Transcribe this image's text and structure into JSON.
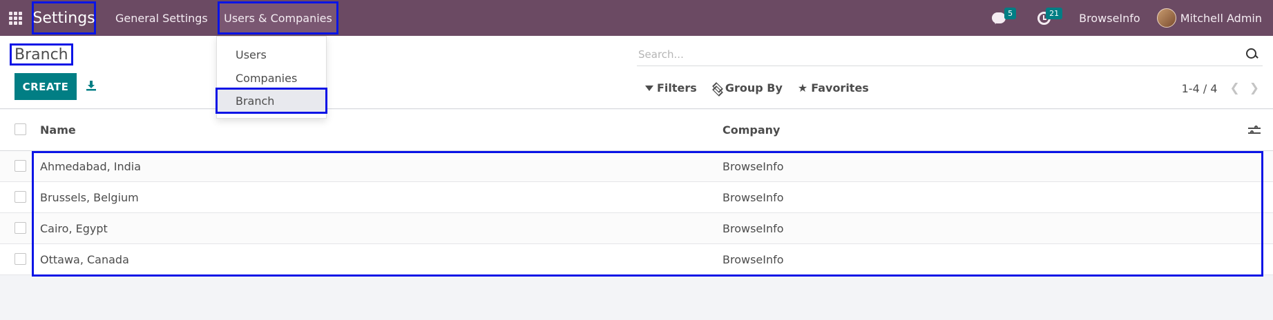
{
  "navbar": {
    "app_name": "Settings",
    "menu": [
      "General Settings",
      "Users & Companies"
    ],
    "messages_count": "5",
    "activities_count": "21",
    "company": "BrowseInfo",
    "user": "Mitchell Admin"
  },
  "dropdown": {
    "items": [
      "Users",
      "Companies",
      "Branch"
    ]
  },
  "control": {
    "breadcrumb": "Branch",
    "create_label": "CREATE",
    "search_placeholder": "Search...",
    "filters_label": "Filters",
    "groupby_label": "Group By",
    "favorites_label": "Favorites",
    "pager": "1-4 / 4"
  },
  "list": {
    "columns": [
      "Name",
      "Company"
    ],
    "rows": [
      {
        "name": "Ahmedabad, India",
        "company": "BrowseInfo"
      },
      {
        "name": "Brussels, Belgium",
        "company": "BrowseInfo"
      },
      {
        "name": "Cairo, Egypt",
        "company": "BrowseInfo"
      },
      {
        "name": "Ottawa, Canada",
        "company": "BrowseInfo"
      }
    ]
  },
  "colors": {
    "navbar": "#6b4a63",
    "primary": "#017e84",
    "highlight": "#0a14e6"
  },
  "icons": [
    "apps-grid-icon",
    "chat-icon",
    "clock-icon",
    "download-icon",
    "search-icon",
    "filter-icon",
    "layers-icon",
    "star-icon",
    "chevron-left-icon",
    "chevron-right-icon",
    "optional-columns-icon"
  ]
}
